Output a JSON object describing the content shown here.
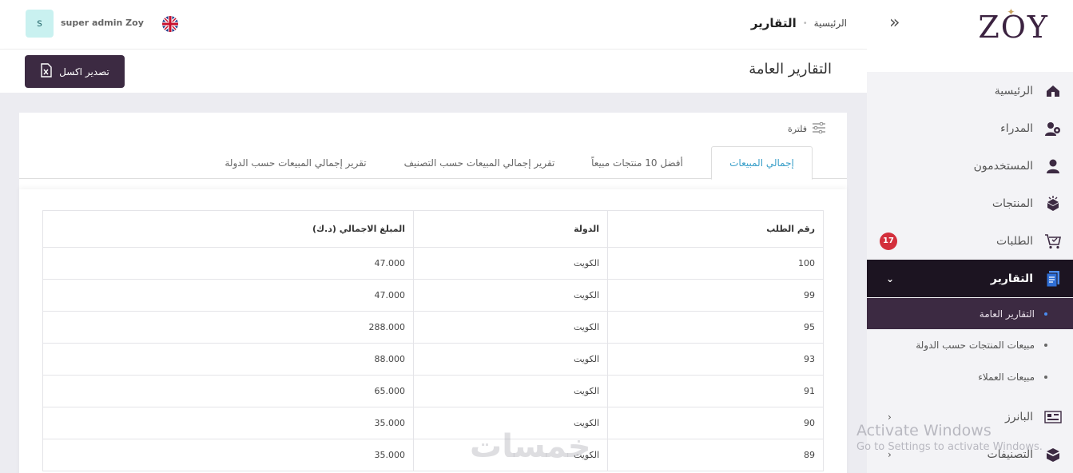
{
  "brand": {
    "logo_text": "ZOY"
  },
  "header": {
    "user_initial": "s",
    "user_name": "super admin Zoy",
    "breadcrumb_home": "الرئيسية",
    "breadcrumb_current": "التقارير"
  },
  "titlebar": {
    "title": "التقارير العامة",
    "export_label": "تصدير اكسل"
  },
  "sidebar": {
    "items": [
      {
        "label": "الرئيسية",
        "icon": "home-icon"
      },
      {
        "label": "المدراء",
        "icon": "admins-icon"
      },
      {
        "label": "المستخدمون",
        "icon": "user-icon"
      },
      {
        "label": "المنتجات",
        "icon": "box-icon"
      },
      {
        "label": "الطلبات",
        "icon": "cart-icon",
        "badge": "17"
      },
      {
        "label": "التقارير",
        "icon": "report-icon"
      },
      {
        "label": "البانرز",
        "icon": "banner-icon"
      },
      {
        "label": "التصنيفات",
        "icon": "category-icon"
      }
    ],
    "sub_items": [
      {
        "label": "التقارير العامة"
      },
      {
        "label": "مبيعات المنتجات حسب الدولة"
      },
      {
        "label": "مبيعات العملاء"
      }
    ]
  },
  "filter": {
    "label": "فلترة"
  },
  "tabs": [
    {
      "label": "إجمالي المبيعات"
    },
    {
      "label": "أفضل 10 منتجات مبيعاً"
    },
    {
      "label": "تقرير إجمالي المبيعات حسب التصنيف"
    },
    {
      "label": "تقرير إجمالي المبيعات حسب الدولة"
    }
  ],
  "table": {
    "headers": [
      "رقم الطلب",
      "الدولة",
      "المبلغ الاجمالي (د.ك)"
    ],
    "rows": [
      [
        "100",
        "الكويت",
        "47.000"
      ],
      [
        "99",
        "الكويت",
        "47.000"
      ],
      [
        "95",
        "الكويت",
        "288.000"
      ],
      [
        "93",
        "الكويت",
        "88.000"
      ],
      [
        "91",
        "الكويت",
        "65.000"
      ],
      [
        "90",
        "الكويت",
        "35.000"
      ],
      [
        "89",
        "الكويت",
        "35.000"
      ]
    ]
  },
  "overlay": {
    "activate_title": "Activate Windows",
    "activate_sub": "Go to Settings to activate Windows.",
    "watermark": "خمسات"
  },
  "colors": {
    "accent_dark": "#3c2a42",
    "sidebar_active": "#1c1421",
    "badge": "#d32f3c",
    "tab_active": "#3a9fc9"
  }
}
